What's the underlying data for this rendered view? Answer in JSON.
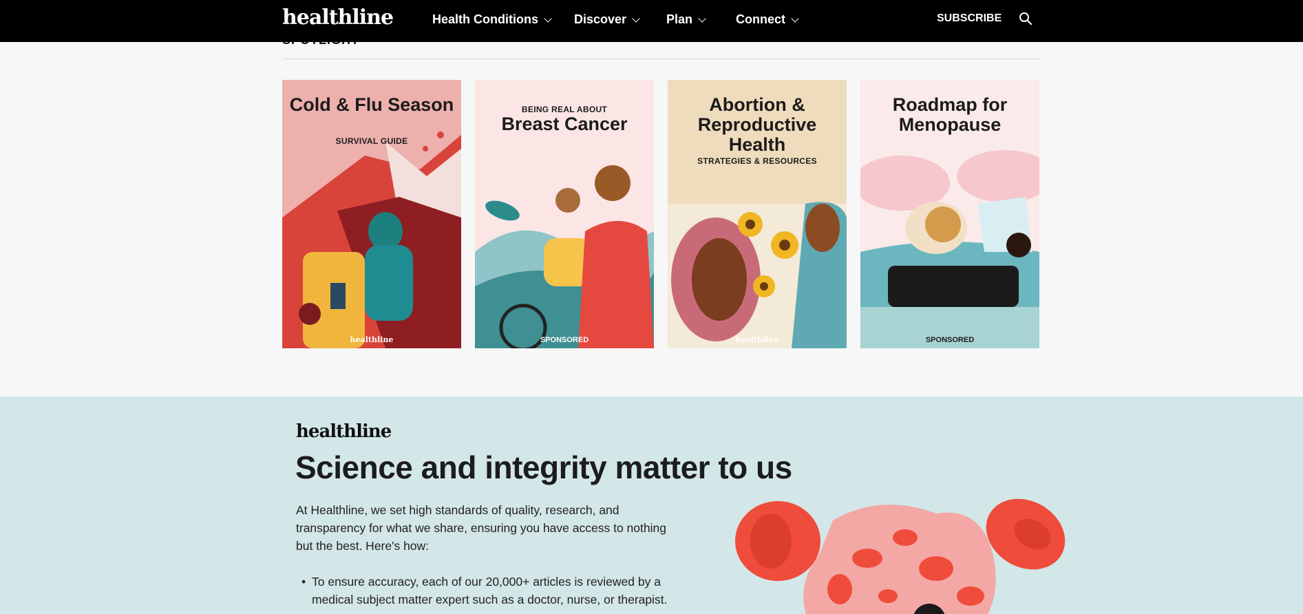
{
  "header": {
    "logo": "healthline",
    "nav": [
      {
        "label": "Health Conditions"
      },
      {
        "label": "Discover"
      },
      {
        "label": "Plan"
      },
      {
        "label": "Connect"
      }
    ],
    "subscribe_label": "SUBSCRIBE",
    "search_icon": "search-icon"
  },
  "spotlight": {
    "heading": "SPOTLIGHT",
    "cards": [
      {
        "title": "Cold & Flu Season",
        "subtitle": "SURVIVAL GUIDE",
        "footer": "healthline"
      },
      {
        "kicker": "BEING REAL ABOUT",
        "title": "Breast Cancer",
        "footer": "SPONSORED"
      },
      {
        "title": "Abortion & Reproductive Health",
        "subtitle": "STRATEGIES & RESOURCES",
        "footer": "healthline"
      },
      {
        "title": "Roadmap for Menopause",
        "footer": "SPONSORED"
      }
    ]
  },
  "integrity": {
    "logo": "healthline",
    "title": "Science and integrity matter to us",
    "body": "At Healthline, we set high standards of quality, research, and transparency for what we share, ensuring you have access to nothing but the best. Here's how:",
    "bullets": [
      "To ensure accuracy, each of our 20,000+ articles is reviewed by a medical subject matter expert such as a doctor, nurse, or therapist."
    ]
  },
  "colors": {
    "header_bg": "#000000",
    "section_bg": "#d3e6e8",
    "page_bg": "#f7f7f7",
    "blood_red": "#ef4c3b"
  }
}
